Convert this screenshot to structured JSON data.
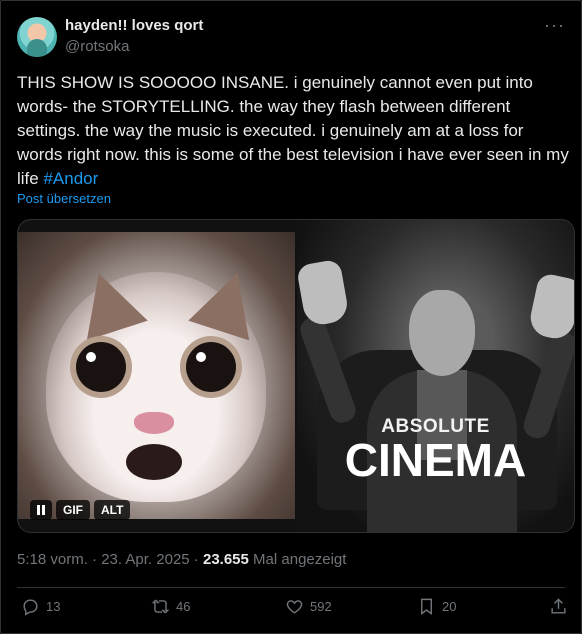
{
  "author": {
    "display_name": "hayden!! loves qort",
    "handle": "@rotsoka"
  },
  "menu": {
    "more_icon": "more-horizontal-icon",
    "glyph": "···"
  },
  "tweet": {
    "text_main": "THIS SHOW IS SOOOOO INSANE. i genuinely cannot even put into words- the STORYTELLING. the way they flash between different settings. the way the music is executed. i genuinely am at a loss for words right now. this is some of the best television i have ever seen in my life ",
    "hashtag": "#Andor",
    "translate_label": "Post übersetzen"
  },
  "media": {
    "gif_controls": {
      "gif_label": "GIF",
      "alt_label": "ALT"
    },
    "meme": {
      "line1": "ABSOLUTE",
      "line2": "CINEMA"
    }
  },
  "meta": {
    "time": "5:18 vorm.",
    "separator1": " · ",
    "date": "23. Apr. 2025",
    "separator2": " · ",
    "views_count": "23.655",
    "views_label": " Mal angezeigt"
  },
  "actions": {
    "replies": "13",
    "reposts": "46",
    "likes": "592",
    "bookmarks": "20"
  },
  "colors": {
    "background": "#000000",
    "text": "#e7e9ea",
    "secondary": "#71767b",
    "accent": "#1d9bf0",
    "border": "#2f3336"
  }
}
